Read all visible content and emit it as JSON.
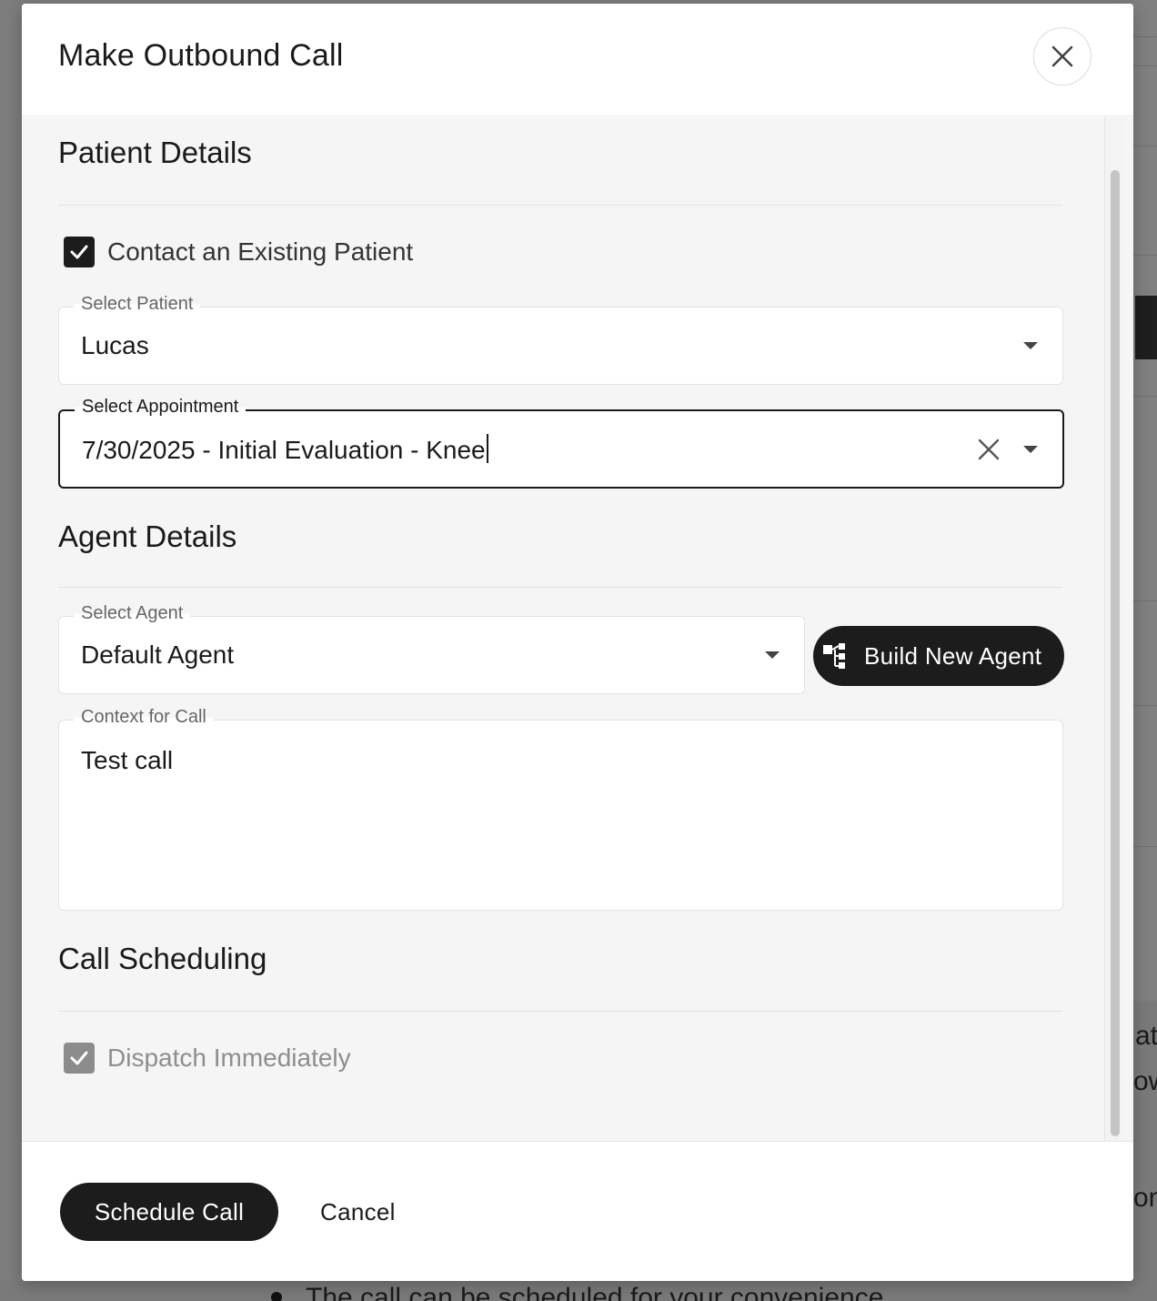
{
  "modal": {
    "title": "Make Outbound Call"
  },
  "patient_details": {
    "section_title": "Patient Details",
    "contact_existing": {
      "label": "Contact an Existing Patient",
      "checked": true
    },
    "select_patient": {
      "label": "Select Patient",
      "value": "Lucas"
    },
    "select_appointment": {
      "label": "Select Appointment",
      "value": "7/30/2025 - Initial Evaluation - Knee"
    }
  },
  "agent_details": {
    "section_title": "Agent Details",
    "select_agent": {
      "label": "Select Agent",
      "value": "Default Agent"
    },
    "build_new_agent_label": "Build New Agent",
    "context": {
      "label": "Context for Call",
      "value": "Test call"
    }
  },
  "call_scheduling": {
    "section_title": "Call Scheduling",
    "dispatch_immediately": {
      "label": "Dispatch Immediately",
      "checked": true,
      "disabled": true
    }
  },
  "footer": {
    "schedule_label": "Schedule Call",
    "cancel_label": "Cancel"
  },
  "background": {
    "fragment_1": "at",
    "fragment_2": "ow",
    "fragment_3": "on",
    "bullet_text": "The call can be scheduled for your convenience"
  },
  "colors": {
    "primary": "#1c1c1c",
    "overlay": "#7a7a7a",
    "body_bg": "#f5f5f5"
  }
}
